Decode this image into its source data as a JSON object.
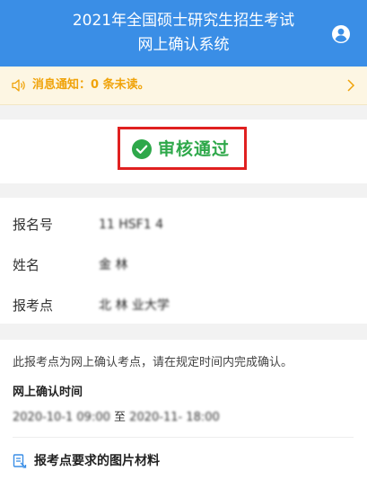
{
  "header": {
    "title_line1": "2021年全国硕士研究生招生考试",
    "title_line2": "网上确认系统",
    "user_icon": "user-circle-icon"
  },
  "notice": {
    "text": "消息通知：0 条未读。",
    "icon": "speaker-icon"
  },
  "status": {
    "text": "审核通过",
    "icon": "check-circle-icon",
    "color": "#2ea84a",
    "frame_color": "#e02020"
  },
  "info": {
    "rows": [
      {
        "label": "报名号",
        "value": "11 HSF1 4"
      },
      {
        "label": "姓名",
        "value": "金 林"
      },
      {
        "label": "报考点",
        "value": "北 林 业大学"
      }
    ]
  },
  "confirm": {
    "description": "此报考点为网上确认考点，请在规定时间内完成确认。",
    "time_title": "网上确认时间",
    "time_start": "2020-10-1 09:00",
    "time_sep": "至",
    "time_end": "2020-11- 18:00",
    "materials_label": "报考点要求的图片材料"
  },
  "colors": {
    "header_bg": "#3a8ee6",
    "notice_text": "#f0a30a"
  }
}
